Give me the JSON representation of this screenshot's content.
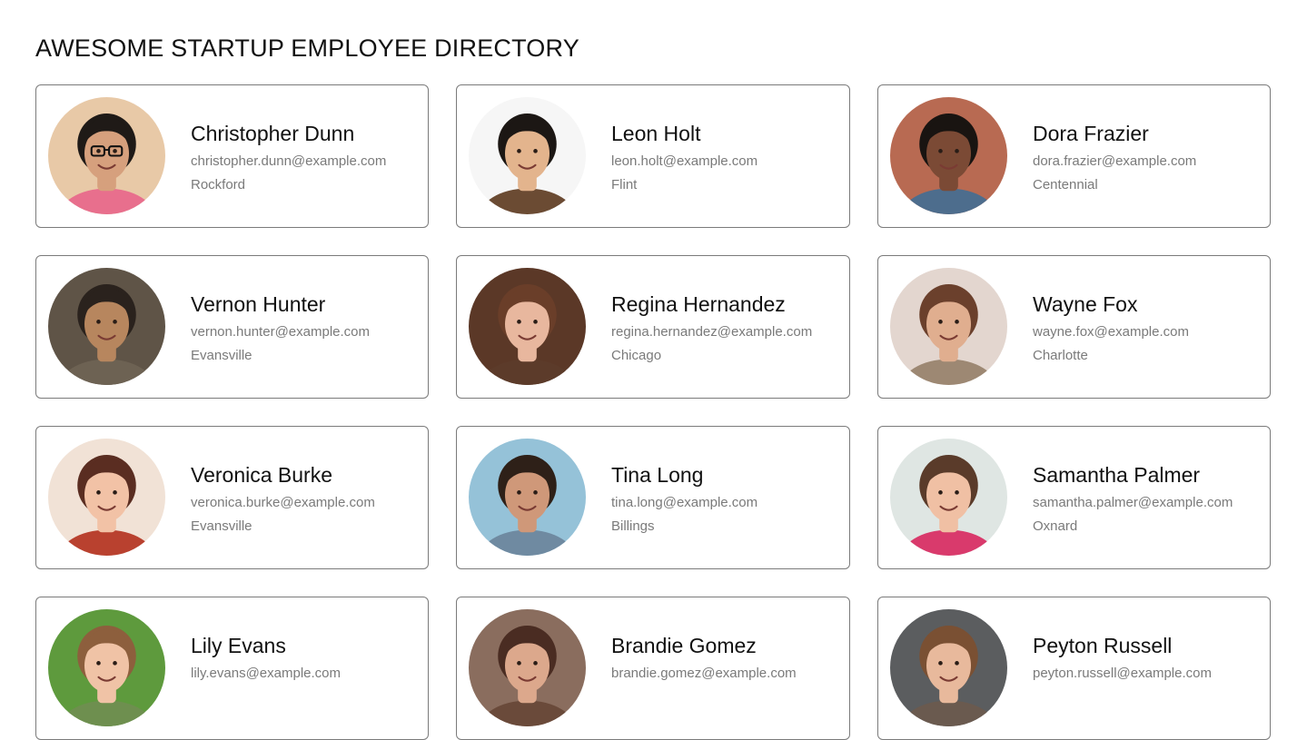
{
  "page": {
    "title": "AWESOME STARTUP EMPLOYEE DIRECTORY"
  },
  "employees": [
    {
      "name": "Christopher Dunn",
      "email": "christopher.dunn@example.com",
      "city": "Rockford",
      "avatar": {
        "bg": "#e8c9a7",
        "skin": "#d6a07d",
        "hair": "#1f1a17",
        "shirt": "#e86f8d",
        "glasses": true
      }
    },
    {
      "name": "Leon Holt",
      "email": "leon.holt@example.com",
      "city": "Flint",
      "avatar": {
        "bg": "#f6f6f6",
        "skin": "#e3b48d",
        "hair": "#1c1714",
        "shirt": "#6b4b33",
        "glasses": false
      }
    },
    {
      "name": "Dora Frazier",
      "email": "dora.frazier@example.com",
      "city": "Centennial",
      "avatar": {
        "bg": "#b86a52",
        "skin": "#7b4a35",
        "hair": "#191411",
        "shirt": "#4d6d8d",
        "glasses": false
      }
    },
    {
      "name": "Vernon Hunter",
      "email": "vernon.hunter@example.com",
      "city": "Evansville",
      "avatar": {
        "bg": "#5f5447",
        "skin": "#b7865e",
        "hair": "#2a221d",
        "shirt": "#6d6253",
        "glasses": false
      }
    },
    {
      "name": "Regina Hernandez",
      "email": "regina.hernandez@example.com",
      "city": "Chicago",
      "avatar": {
        "bg": "#5b3827",
        "skin": "#e8b79e",
        "hair": "#6a3e29",
        "shirt": "#5c3b2a",
        "glasses": false
      }
    },
    {
      "name": "Wayne Fox",
      "email": "wayne.fox@example.com",
      "city": "Charlotte",
      "avatar": {
        "bg": "#e3d6cf",
        "skin": "#e0ae8f",
        "hair": "#6b402c",
        "shirt": "#9d8873",
        "glasses": false
      }
    },
    {
      "name": "Veronica Burke",
      "email": "veronica.burke@example.com",
      "city": "Evansville",
      "avatar": {
        "bg": "#f1e2d6",
        "skin": "#f2c2a6",
        "hair": "#5a2d21",
        "shirt": "#b9412f",
        "glasses": false
      }
    },
    {
      "name": "Tina Long",
      "email": "tina.long@example.com",
      "city": "Billings",
      "avatar": {
        "bg": "#95c2d8",
        "skin": "#cf9879",
        "hair": "#2e2018",
        "shirt": "#6f8aa1",
        "glasses": false
      }
    },
    {
      "name": "Samantha Palmer",
      "email": "samantha.palmer@example.com",
      "city": "Oxnard",
      "avatar": {
        "bg": "#dfe6e3",
        "skin": "#f0c0a4",
        "hair": "#5a3b2a",
        "shirt": "#d93a6c",
        "glasses": false
      }
    },
    {
      "name": "Lily Evans",
      "email": "lily.evans@example.com",
      "city": "",
      "avatar": {
        "bg": "#5e9a3d",
        "skin": "#f0c3a6",
        "hair": "#8d5f3d",
        "shirt": "#6e8f4f",
        "glasses": false
      }
    },
    {
      "name": "Brandie Gomez",
      "email": "brandie.gomez@example.com",
      "city": "",
      "avatar": {
        "bg": "#8a6d5e",
        "skin": "#dca88c",
        "hair": "#4a2c22",
        "shirt": "#6a4a3a",
        "glasses": false
      }
    },
    {
      "name": "Peyton Russell",
      "email": "peyton.russell@example.com",
      "city": "",
      "avatar": {
        "bg": "#5b5d5f",
        "skin": "#e8b99c",
        "hair": "#7a5033",
        "shirt": "#6a5a4f",
        "glasses": false
      }
    }
  ]
}
